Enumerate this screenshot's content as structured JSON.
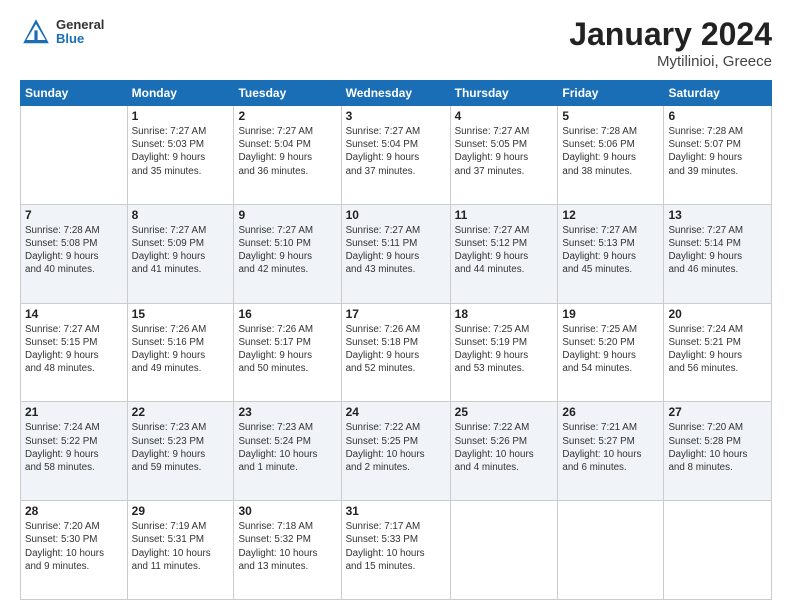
{
  "header": {
    "logo_general": "General",
    "logo_blue": "Blue",
    "title": "January 2024",
    "subtitle": "Mytilinioi, Greece"
  },
  "weekdays": [
    "Sunday",
    "Monday",
    "Tuesday",
    "Wednesday",
    "Thursday",
    "Friday",
    "Saturday"
  ],
  "weeks": [
    [
      {
        "day": "",
        "info": ""
      },
      {
        "day": "1",
        "info": "Sunrise: 7:27 AM\nSunset: 5:03 PM\nDaylight: 9 hours\nand 35 minutes."
      },
      {
        "day": "2",
        "info": "Sunrise: 7:27 AM\nSunset: 5:04 PM\nDaylight: 9 hours\nand 36 minutes."
      },
      {
        "day": "3",
        "info": "Sunrise: 7:27 AM\nSunset: 5:04 PM\nDaylight: 9 hours\nand 37 minutes."
      },
      {
        "day": "4",
        "info": "Sunrise: 7:27 AM\nSunset: 5:05 PM\nDaylight: 9 hours\nand 37 minutes."
      },
      {
        "day": "5",
        "info": "Sunrise: 7:28 AM\nSunset: 5:06 PM\nDaylight: 9 hours\nand 38 minutes."
      },
      {
        "day": "6",
        "info": "Sunrise: 7:28 AM\nSunset: 5:07 PM\nDaylight: 9 hours\nand 39 minutes."
      }
    ],
    [
      {
        "day": "7",
        "info": "Sunrise: 7:28 AM\nSunset: 5:08 PM\nDaylight: 9 hours\nand 40 minutes."
      },
      {
        "day": "8",
        "info": "Sunrise: 7:27 AM\nSunset: 5:09 PM\nDaylight: 9 hours\nand 41 minutes."
      },
      {
        "day": "9",
        "info": "Sunrise: 7:27 AM\nSunset: 5:10 PM\nDaylight: 9 hours\nand 42 minutes."
      },
      {
        "day": "10",
        "info": "Sunrise: 7:27 AM\nSunset: 5:11 PM\nDaylight: 9 hours\nand 43 minutes."
      },
      {
        "day": "11",
        "info": "Sunrise: 7:27 AM\nSunset: 5:12 PM\nDaylight: 9 hours\nand 44 minutes."
      },
      {
        "day": "12",
        "info": "Sunrise: 7:27 AM\nSunset: 5:13 PM\nDaylight: 9 hours\nand 45 minutes."
      },
      {
        "day": "13",
        "info": "Sunrise: 7:27 AM\nSunset: 5:14 PM\nDaylight: 9 hours\nand 46 minutes."
      }
    ],
    [
      {
        "day": "14",
        "info": "Sunrise: 7:27 AM\nSunset: 5:15 PM\nDaylight: 9 hours\nand 48 minutes."
      },
      {
        "day": "15",
        "info": "Sunrise: 7:26 AM\nSunset: 5:16 PM\nDaylight: 9 hours\nand 49 minutes."
      },
      {
        "day": "16",
        "info": "Sunrise: 7:26 AM\nSunset: 5:17 PM\nDaylight: 9 hours\nand 50 minutes."
      },
      {
        "day": "17",
        "info": "Sunrise: 7:26 AM\nSunset: 5:18 PM\nDaylight: 9 hours\nand 52 minutes."
      },
      {
        "day": "18",
        "info": "Sunrise: 7:25 AM\nSunset: 5:19 PM\nDaylight: 9 hours\nand 53 minutes."
      },
      {
        "day": "19",
        "info": "Sunrise: 7:25 AM\nSunset: 5:20 PM\nDaylight: 9 hours\nand 54 minutes."
      },
      {
        "day": "20",
        "info": "Sunrise: 7:24 AM\nSunset: 5:21 PM\nDaylight: 9 hours\nand 56 minutes."
      }
    ],
    [
      {
        "day": "21",
        "info": "Sunrise: 7:24 AM\nSunset: 5:22 PM\nDaylight: 9 hours\nand 58 minutes."
      },
      {
        "day": "22",
        "info": "Sunrise: 7:23 AM\nSunset: 5:23 PM\nDaylight: 9 hours\nand 59 minutes."
      },
      {
        "day": "23",
        "info": "Sunrise: 7:23 AM\nSunset: 5:24 PM\nDaylight: 10 hours\nand 1 minute."
      },
      {
        "day": "24",
        "info": "Sunrise: 7:22 AM\nSunset: 5:25 PM\nDaylight: 10 hours\nand 2 minutes."
      },
      {
        "day": "25",
        "info": "Sunrise: 7:22 AM\nSunset: 5:26 PM\nDaylight: 10 hours\nand 4 minutes."
      },
      {
        "day": "26",
        "info": "Sunrise: 7:21 AM\nSunset: 5:27 PM\nDaylight: 10 hours\nand 6 minutes."
      },
      {
        "day": "27",
        "info": "Sunrise: 7:20 AM\nSunset: 5:28 PM\nDaylight: 10 hours\nand 8 minutes."
      }
    ],
    [
      {
        "day": "28",
        "info": "Sunrise: 7:20 AM\nSunset: 5:30 PM\nDaylight: 10 hours\nand 9 minutes."
      },
      {
        "day": "29",
        "info": "Sunrise: 7:19 AM\nSunset: 5:31 PM\nDaylight: 10 hours\nand 11 minutes."
      },
      {
        "day": "30",
        "info": "Sunrise: 7:18 AM\nSunset: 5:32 PM\nDaylight: 10 hours\nand 13 minutes."
      },
      {
        "day": "31",
        "info": "Sunrise: 7:17 AM\nSunset: 5:33 PM\nDaylight: 10 hours\nand 15 minutes."
      },
      {
        "day": "",
        "info": ""
      },
      {
        "day": "",
        "info": ""
      },
      {
        "day": "",
        "info": ""
      }
    ]
  ]
}
